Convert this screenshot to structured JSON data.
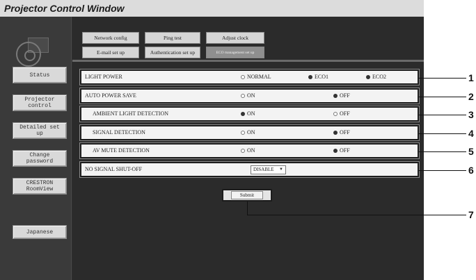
{
  "window": {
    "title": "Projector Control Window"
  },
  "sidebar": {
    "items": [
      {
        "label": "Status"
      },
      {
        "label": "Projector control"
      },
      {
        "label": "Detailed set up"
      },
      {
        "label": "Change password"
      },
      {
        "label": "CRESTRON RoomView"
      },
      {
        "label": "Japanese"
      }
    ]
  },
  "tabs": {
    "row1": [
      "Network config",
      "Ping test",
      "Adjust clock"
    ],
    "row2": [
      "E-mail set up",
      "Authentication set up",
      "ECO management set up"
    ]
  },
  "settings": {
    "light_power": {
      "label": "LIGHT POWER",
      "options": [
        "NORMAL",
        "ECO1",
        "ECO2"
      ]
    },
    "auto_power_save": {
      "label": "AUTO POWER SAVE",
      "on": "ON",
      "off": "OFF"
    },
    "ambient_light": {
      "label": "AMBIENT LIGHT DETECTION",
      "on": "ON",
      "off": "OFF"
    },
    "signal_detection": {
      "label": "SIGNAL DETECTION",
      "on": "ON",
      "off": "OFF"
    },
    "av_mute": {
      "label": "AV MUTE DETECTION",
      "on": "ON",
      "off": "OFF"
    },
    "no_signal": {
      "label": "NO SIGNAL SHUT-OFF",
      "value": "DISABLE"
    }
  },
  "submit_label": "Submit",
  "callouts": [
    "1",
    "2",
    "3",
    "4",
    "5",
    "6",
    "7"
  ],
  "icons": {
    "logo": "projector-logo-icon",
    "dropdown": "chevron-down-icon"
  }
}
